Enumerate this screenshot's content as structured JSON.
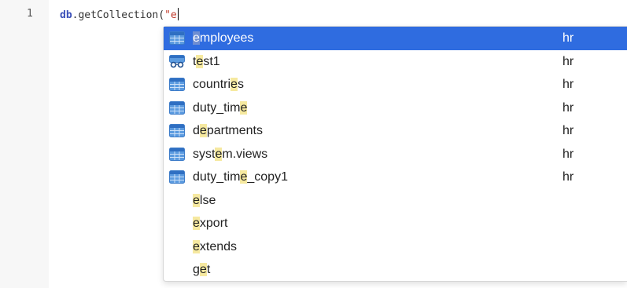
{
  "editor": {
    "line_number": "1",
    "code": {
      "object": "db",
      "dot": ".",
      "method": "getCollection(",
      "string": "\"e"
    }
  },
  "suggestions": [
    {
      "pre": "",
      "match": "e",
      "post": "mployees",
      "schema": "hr",
      "icon": "table-icon",
      "selected": true
    },
    {
      "pre": "t",
      "match": "e",
      "post": "st1",
      "schema": "hr",
      "icon": "view-icon"
    },
    {
      "pre": "countri",
      "match": "e",
      "post": "s",
      "schema": "hr",
      "icon": "table-icon"
    },
    {
      "pre": "duty_tim",
      "match": "e",
      "post": "",
      "schema": "hr",
      "icon": "table-icon"
    },
    {
      "pre": "d",
      "match": "e",
      "post": "partments",
      "schema": "hr",
      "icon": "table-icon"
    },
    {
      "pre": "syst",
      "match": "e",
      "post": "m.views",
      "schema": "hr",
      "icon": "table-icon"
    },
    {
      "pre": "duty_tim",
      "match": "e",
      "post": "_copy1",
      "schema": "hr",
      "icon": "table-icon"
    },
    {
      "pre": "",
      "match": "e",
      "post": "lse",
      "schema": "",
      "icon": ""
    },
    {
      "pre": "",
      "match": "e",
      "post": "xport",
      "schema": "",
      "icon": ""
    },
    {
      "pre": "",
      "match": "e",
      "post": "xtends",
      "schema": "",
      "icon": ""
    },
    {
      "pre": "g",
      "match": "e",
      "post": "t",
      "schema": "",
      "icon": ""
    }
  ],
  "colors": {
    "selection": "#2f6ce0",
    "match_highlight": "#f6e9a0",
    "table_icon": "#4a90d9"
  }
}
